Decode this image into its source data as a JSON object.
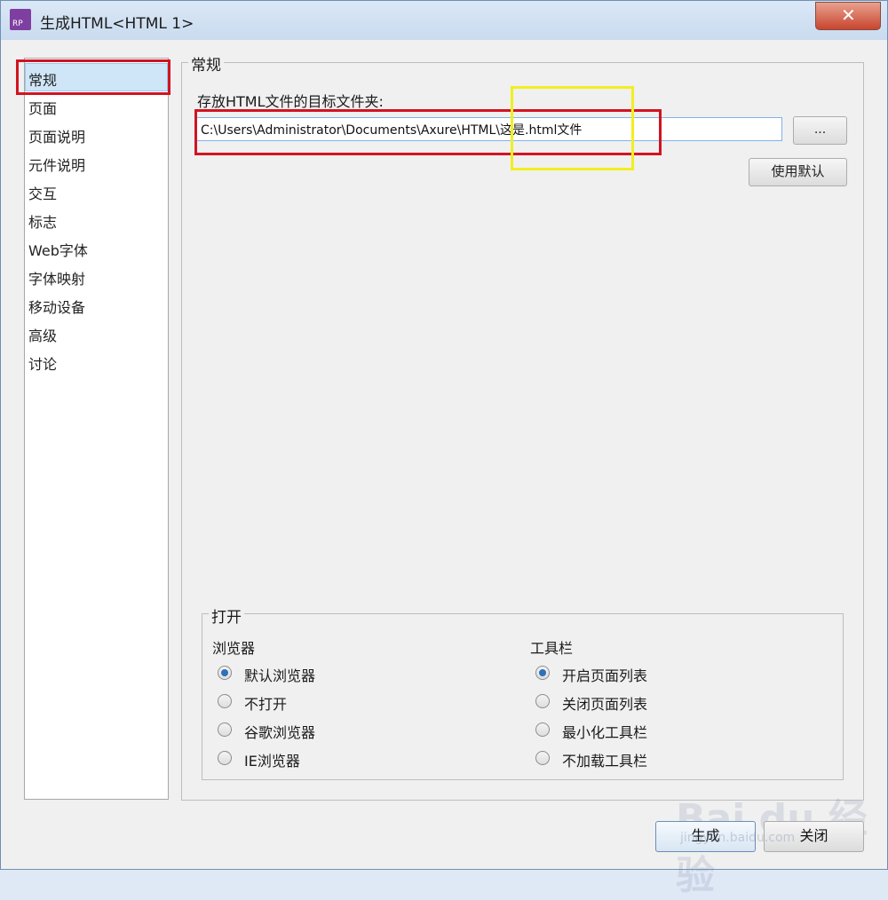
{
  "window": {
    "title": "生成HTML<HTML 1>",
    "icon_text": "RP",
    "close_glyph": "✕"
  },
  "sidebar": {
    "items": [
      {
        "label": "常规",
        "selected": true
      },
      {
        "label": "页面"
      },
      {
        "label": "页面说明"
      },
      {
        "label": "元件说明"
      },
      {
        "label": "交互"
      },
      {
        "label": "标志"
      },
      {
        "label": "Web字体"
      },
      {
        "label": "字体映射"
      },
      {
        "label": "移动设备"
      },
      {
        "label": "高级"
      },
      {
        "label": "讨论"
      }
    ]
  },
  "general": {
    "group_title": "常规",
    "folder_label": "存放HTML文件的目标文件夹:",
    "folder_value": "C:\\Users\\Administrator\\Documents\\Axure\\HTML\\这是.html文件",
    "browse_label": "...",
    "default_label": "使用默认"
  },
  "open": {
    "group_title": "打开",
    "browser": {
      "title": "浏览器",
      "options": [
        "默认浏览器",
        "不打开",
        "谷歌浏览器",
        "IE浏览器"
      ],
      "selected": "默认浏览器"
    },
    "toolbar": {
      "title": "工具栏",
      "options": [
        "开启页面列表",
        "关闭页面列表",
        "最小化工具栏",
        "不加载工具栏"
      ],
      "selected": "开启页面列表"
    }
  },
  "footer": {
    "generate_label": "生成",
    "close_label": "关闭"
  },
  "watermark": {
    "brand": "Bai du 经验",
    "url": "jingyan.baidu.com"
  },
  "colors": {
    "annotation_red": "#d11421",
    "annotation_yellow": "#f1ef1f",
    "selection": "#cfe6f8",
    "radio_checked": "#2d70b9"
  }
}
